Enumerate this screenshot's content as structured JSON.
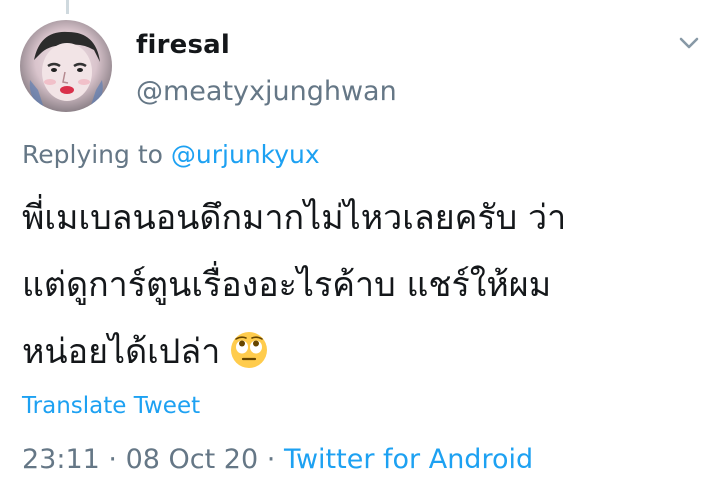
{
  "tweet": {
    "display_name": "firesal",
    "handle": "@meatyxjunghwan",
    "replying_prefix": "Replying to",
    "replying_to": "@urjunkyux",
    "text_lines": [
      "พี่เมเบลนอนดึกมากไม่ไหวเลยครับ ว่า",
      "แต่ดูการ์ตูนเรื่องอะไรค้าบ แชร์ให้ผม",
      "หน่อยได้เปล่า"
    ],
    "emoji_icon": "face-with-rolling-eyes-icon",
    "translate_label": "Translate Tweet",
    "time": "23:11",
    "date": "08 Oct 20",
    "source": "Twitter for Android",
    "separator": "·"
  },
  "colors": {
    "text": "#14171a",
    "secondary": "#657786",
    "link": "#1da1f2"
  }
}
